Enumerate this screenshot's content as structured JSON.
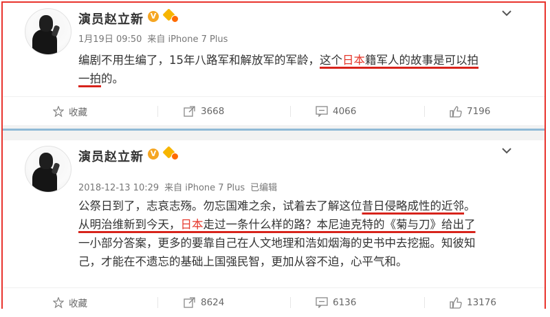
{
  "posts": [
    {
      "author": "演员赵立新",
      "badge_letter": "V",
      "timestamp": "1月19日 09:50",
      "source": "来自 iPhone 7 Plus",
      "edited": "",
      "content": {
        "l1_a": "编剧不用生编了，15年八路军和解放军的军龄，",
        "l1_b": "这个",
        "l1_c": "日本",
        "l1_d": "籍军人的故事是可以拍",
        "l2_a": "一拍",
        "l2_b": "的。"
      },
      "actions": {
        "favorite": "收藏",
        "repost": "3668",
        "comment": "4066",
        "like": "7196"
      }
    },
    {
      "author": "演员赵立新",
      "badge_letter": "V",
      "timestamp": "2018-12-13 10:29",
      "source": "来自 iPhone 7 Plus",
      "edited": "已编辑",
      "content": {
        "l1_a": "公祭日到了，志哀志殇。勿忘国难之余，试着去了解这位",
        "l1_b": "昔日侵略成性的近邻",
        "l1_c": "。",
        "l2_a": "从明治维新到今天，",
        "l2_b": "日本",
        "l2_c": "走过一条什么样的路？本尼迪克特的",
        "l2_d": "《菊与刀》给出了",
        "l3": "一小部分答案，更多的要靠自己在人文地理和浩如烟海的史书中去挖掘。知彼知",
        "l4": "己，才能在不遗忘的基础上国强民智，更加从容不迫，心平气和。"
      },
      "actions": {
        "favorite": "收藏",
        "repost": "8624",
        "comment": "6136",
        "like": "13176"
      }
    }
  ],
  "colors": {
    "highlight_red": "#e6372b",
    "underline_red": "#d7231b",
    "badge_orange": "#f5a623",
    "divider_blue": "#8fb9d6"
  },
  "icons": [
    "chevron-down-icon",
    "star-icon",
    "repost-icon",
    "comment-icon",
    "like-icon",
    "verified-badge-icon",
    "vip-icon"
  ]
}
